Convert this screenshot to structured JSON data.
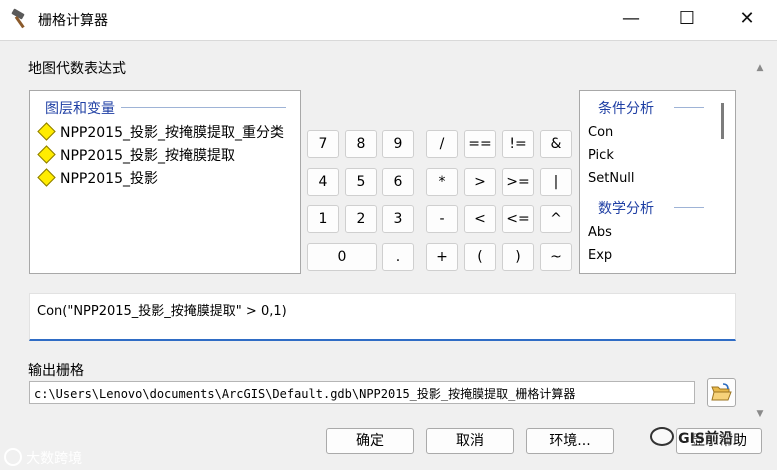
{
  "window": {
    "title": "栅格计算器",
    "minimize": "—",
    "maximize": "☐",
    "close": "✕"
  },
  "map_algebra_label": "地图代数表达式",
  "layers": {
    "heading": "图层和变量",
    "items": [
      "NPP2015_投影_按掩膜提取_重分类",
      "NPP2015_投影_按掩膜提取",
      "NPP2015_投影"
    ]
  },
  "keypad": {
    "digits": [
      "7",
      "8",
      "9",
      "4",
      "5",
      "6",
      "1",
      "2",
      "3",
      "0",
      "."
    ],
    "ops": [
      "/",
      "==",
      "!=",
      "&",
      "*",
      ">",
      ">=",
      "|",
      "-",
      "<",
      "<=",
      "^",
      "+",
      "(",
      ")",
      "~"
    ]
  },
  "functions": {
    "cat_conditional": "条件分析",
    "conditional": [
      "Con",
      "Pick",
      "SetNull"
    ],
    "cat_math": "数学分析",
    "math": [
      "Abs",
      "Exp"
    ]
  },
  "expression": "Con(\"NPP2015_投影_按掩膜提取\" > 0,1)",
  "output_label": "输出栅格",
  "output_path": "c:\\Users\\Lenovo\\documents\\ArcGIS\\Default.gdb\\NPP2015_投影_按掩膜提取_栅格计算器",
  "buttons": {
    "ok": "确定",
    "cancel": "取消",
    "env": "环境...",
    "help": "显示帮助"
  },
  "watermark_left": "大数跨境",
  "watermark_right": "GIS前沿",
  "colors": {
    "heading_blue": "#1f3fa4",
    "focus_blue": "#2f6cc5",
    "layer_icon": "#ffec00"
  }
}
